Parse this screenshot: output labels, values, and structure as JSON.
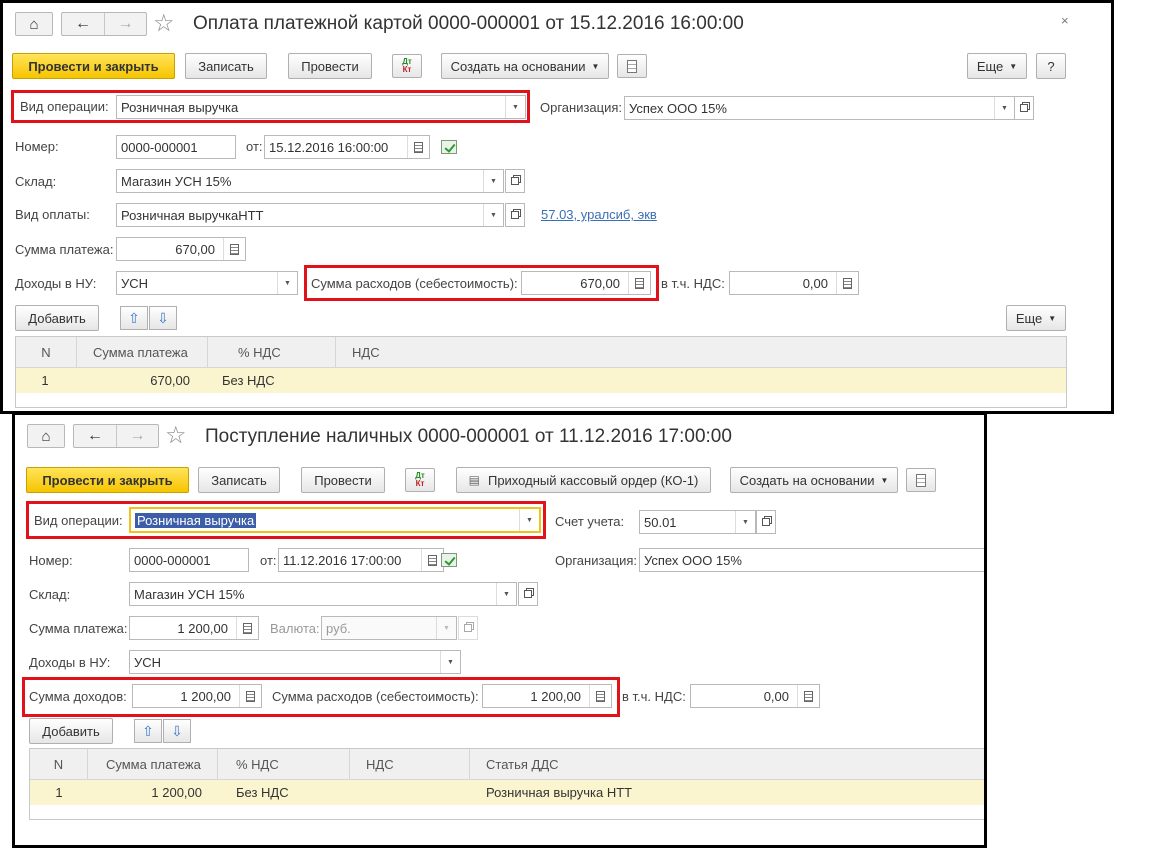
{
  "form1": {
    "title": "Оплата платежной картой 0000-000001 от 15.12.2016 16:00:00",
    "close": "×",
    "toolbar": {
      "post_close": "Провести и закрыть",
      "save": "Записать",
      "post": "Провести",
      "dtkt_top": "Дт",
      "dtkt_bottom": "Кт",
      "create_based": "Создать на основании",
      "more": "Еще",
      "help": "?"
    },
    "op_type_label": "Вид операции:",
    "op_type_value": "Розничная выручка",
    "org_label": "Организация:",
    "org_value": "Успех ООО 15%",
    "number_label": "Номер:",
    "number_value": "0000-000001",
    "from_label": "от:",
    "date_value": "15.12.2016 16:00:00",
    "warehouse_label": "Склад:",
    "warehouse_value": "Магазин УСН 15%",
    "pay_type_label": "Вид оплаты:",
    "pay_type_value": "Розничная выручкаНТТ",
    "pay_type_link": "57.03, уралсиб, экв",
    "amount_label": "Сумма платежа:",
    "amount_value": "670,00",
    "income_label": "Доходы в НУ:",
    "income_value": "УСН",
    "expense_label": "Сумма расходов (себестоимость):",
    "expense_value": "670,00",
    "vat_label": "в т.ч. НДС:",
    "vat_value": "0,00",
    "add": "Добавить",
    "more2": "Еще",
    "table": {
      "headers": [
        "N",
        "Сумма платежа",
        "% НДС",
        "НДС"
      ],
      "rows": [
        [
          "1",
          "670,00",
          "Без НДС",
          ""
        ]
      ]
    }
  },
  "form2": {
    "title": "Поступление наличных 0000-000001 от 11.12.2016 17:00:00",
    "toolbar": {
      "post_close": "Провести и закрыть",
      "save": "Записать",
      "post": "Провести",
      "dtkt_top": "Дт",
      "dtkt_bottom": "Кт",
      "print": "Приходный кассовый ордер (КО-1)",
      "create_based": "Создать на основании"
    },
    "op_type_label": "Вид операции:",
    "op_type_value": "Розничная выручка",
    "account_label": "Счет учета:",
    "account_value": "50.01",
    "number_label": "Номер:",
    "number_value": "0000-000001",
    "from_label": "от:",
    "date_value": "11.12.2016 17:00:00",
    "org_label": "Организация:",
    "org_value": "Успех ООО 15%",
    "warehouse_label": "Склад:",
    "warehouse_value": "Магазин УСН 15%",
    "amount_label": "Сумма платежа:",
    "amount_value": "1 200,00",
    "currency_label": "Валюта:",
    "currency_value": "руб.",
    "income_label": "Доходы в НУ:",
    "income_value": "УСН",
    "income_sum_label": "Сумма доходов:",
    "income_sum_value": "1 200,00",
    "expense_label": "Сумма расходов (себестоимость):",
    "expense_value": "1 200,00",
    "vat_label": "в т.ч. НДС:",
    "vat_value": "0,00",
    "add": "Добавить",
    "table": {
      "headers": [
        "N",
        "Сумма платежа",
        "% НДС",
        "НДС",
        "Статья ДДС"
      ],
      "rows": [
        [
          "1",
          "1 200,00",
          "Без НДС",
          "",
          "Розничная выручка НТТ"
        ]
      ]
    }
  },
  "colors": {
    "highlight": "#e0121a",
    "accent_button": "#f6c500",
    "row_selected": "#fbf5cf",
    "link": "#3a6fb5"
  }
}
